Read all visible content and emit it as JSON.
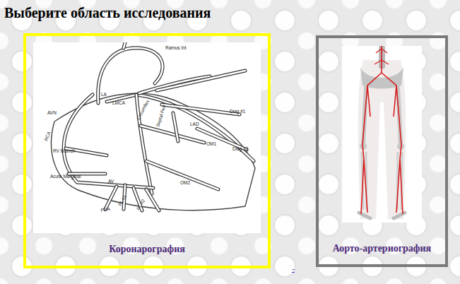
{
  "page": {
    "title": "Выберите область исследования"
  },
  "cards": [
    {
      "label": "Коронарография",
      "selected": true,
      "kind": "coronary"
    },
    {
      "label": "Аорто-артериография",
      "selected": false,
      "kind": "aorta"
    }
  ],
  "diagram": {
    "labels": [
      "Ramus Int",
      "LA",
      "LMCA",
      "AVN",
      "Circumflex",
      "Septal Perf",
      "Diag #1",
      "LAD",
      "RCA",
      "RV Branch",
      "OM1",
      "Diag #2",
      "Acute Marginal",
      "AV",
      "OM2",
      "PL #1",
      "PL #2",
      "PDA"
    ]
  },
  "link_mark": "-"
}
